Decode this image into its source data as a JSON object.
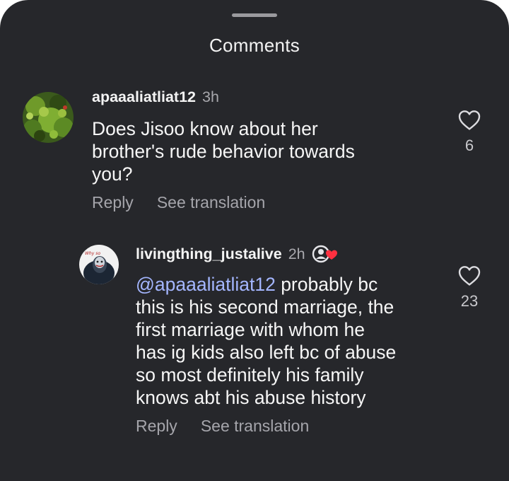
{
  "sheet": {
    "title": "Comments"
  },
  "comments": [
    {
      "username": "apaaaliatliat12",
      "time": "3h",
      "text": "Does Jisoo know about her\nbrother's rude behavior towards\nyou?",
      "reply_label": "Reply",
      "translate_label": "See translation",
      "likes": "6",
      "avatar_icon": "plant-photo-avatar"
    },
    {
      "username": "livingthing_justalive",
      "time": "2h",
      "mention": "@apaaaliatliat12",
      "text": " probably bc\nthis is his second marriage, the\nfirst marriage with whom he\nhas ig kids also left bc of abuse\nso most definitely his family\nknows abt his abuse history",
      "reply_label": "Reply",
      "translate_label": "See translation",
      "likes": "23",
      "avatar_icon": "joker-avatar",
      "badge_icon": "profile-heart-badge-icon"
    }
  ],
  "colors": {
    "background": "#26272b",
    "mention": "#a4b6ff",
    "secondary_text": "#a5a5ab",
    "heart_badge": "#ff3040"
  }
}
